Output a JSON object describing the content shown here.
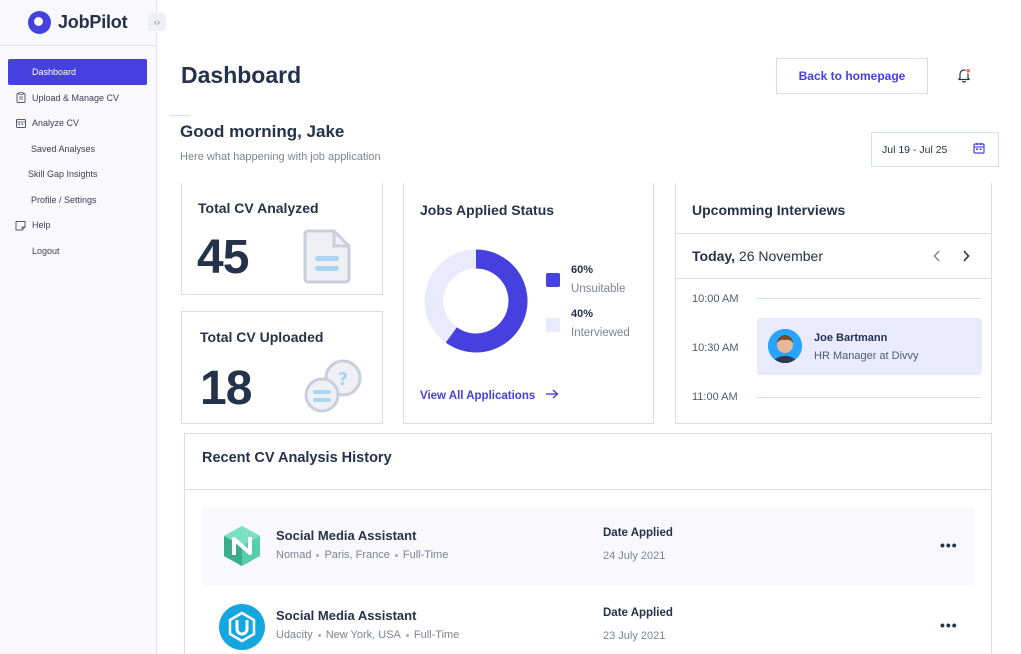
{
  "app": {
    "name": "JobPilot",
    "collapse_icon": "‹›"
  },
  "sidebar": {
    "items": [
      {
        "label": "Dashboard",
        "icon": "none",
        "active": true
      },
      {
        "label": "Upload & Manage CV",
        "icon": "clipboard-icon"
      },
      {
        "label": "Analyze CV",
        "icon": "calendar-icon"
      },
      {
        "label": "Saved Analyses"
      },
      {
        "label": "Skill Gap Insights"
      },
      {
        "label": "Profile / Settings"
      },
      {
        "label": "Help",
        "icon": "note-icon"
      },
      {
        "label": "Logout"
      }
    ]
  },
  "header": {
    "title": "Dashboard",
    "back_label": "Back to homepage"
  },
  "greeting": {
    "title": "Good morning, Jake",
    "subtitle": "Here what happening with job application",
    "date_range": "Jul 19 - Jul 25"
  },
  "stats": {
    "analyzed": {
      "label": "Total CV Analyzed",
      "value": "45"
    },
    "uploaded": {
      "label": "Total CV Uploaded",
      "value": "18"
    }
  },
  "jobs_status": {
    "title": "Jobs Applied Status",
    "unsuitable": {
      "value": "60%",
      "label": "Unsuitable",
      "fraction": 0.6
    },
    "interviewed": {
      "value": "40%",
      "label": "Interviewed",
      "fraction": 0.4
    },
    "link": "View All Applications",
    "colors": {
      "primary": "#4640DE",
      "secondary": "#E9EBFD"
    }
  },
  "interviews": {
    "title": "Upcomming Interviews",
    "today_bold": "Today,",
    "today_date": " 26 November",
    "times": [
      "10:00 AM",
      "10:30 AM",
      "11:00 AM"
    ],
    "event": {
      "name": "Joe Bartmann",
      "role": "HR Manager at Divvy"
    }
  },
  "history": {
    "title": "Recent CV Analysis History",
    "date_label": "Date Applied",
    "rows": [
      {
        "title": "Social Media Assistant",
        "company": "Nomad",
        "location": "Paris, France",
        "type": "Full-Time",
        "date": "24 July 2021",
        "logo": "nomad-logo"
      },
      {
        "title": "Social Media Assistant",
        "company": "Udacity",
        "location": "New York, USA",
        "type": "Full-Time",
        "date": "23 July 2021",
        "logo": "udacity-logo"
      }
    ],
    "more": "•••"
  }
}
